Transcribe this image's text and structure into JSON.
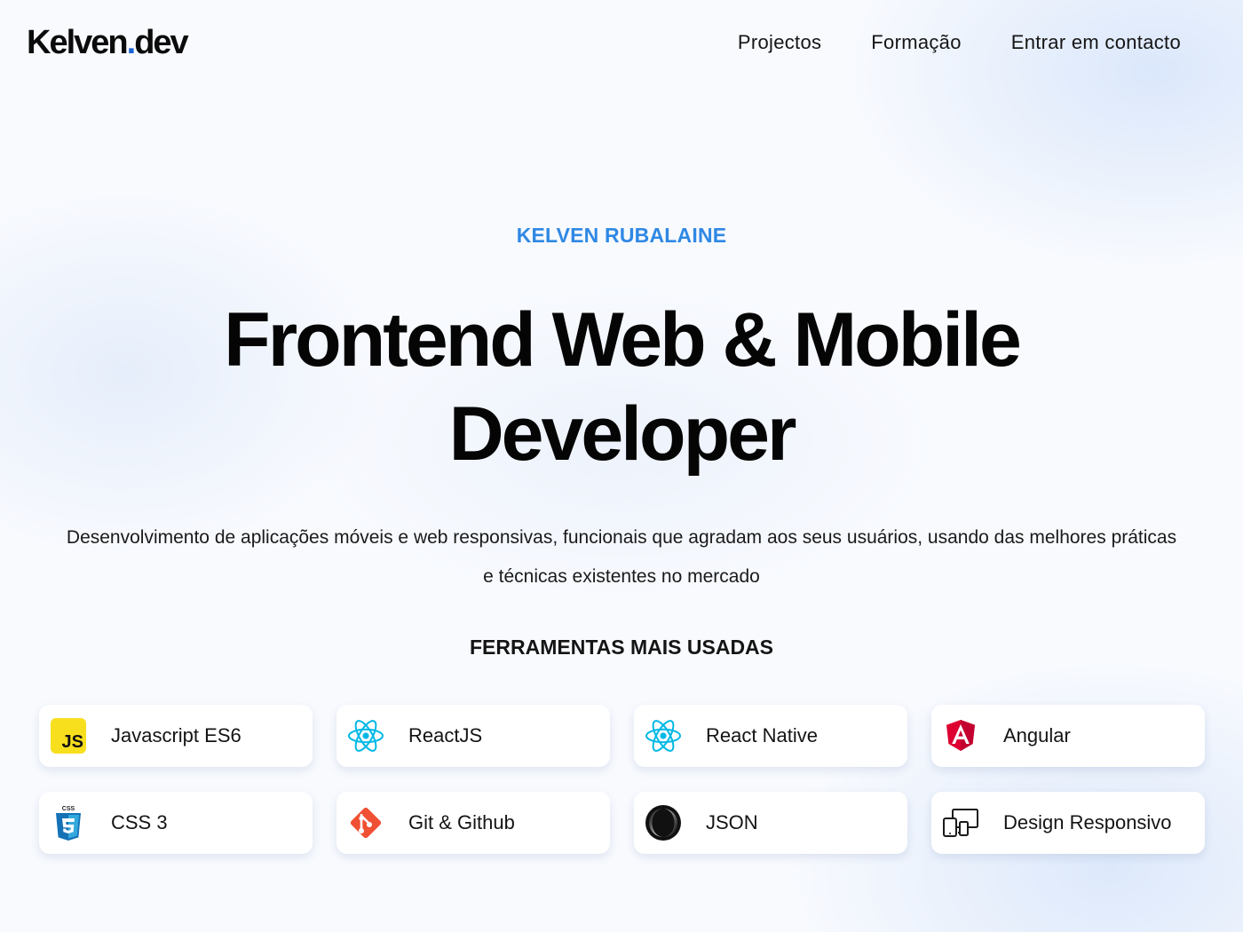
{
  "header": {
    "logo_main": "Kelven",
    "logo_dot": ".",
    "logo_suffix": "dev",
    "nav": [
      {
        "label": "Projectos"
      },
      {
        "label": "Formação"
      },
      {
        "label": "Entrar em contacto"
      }
    ]
  },
  "hero": {
    "eyebrow": "KELVEN RUBALAINE",
    "title": "Frontend Web & Mobile Developer",
    "description": "Desenvolvimento de aplicações móveis e web responsivas, funcionais que agradam aos seus usuários, usando das melhores práticas e técnicas existentes no mercado"
  },
  "tools": {
    "heading": "FERRAMENTAS MAIS USADAS",
    "items": [
      {
        "label": "Javascript ES6",
        "icon": "javascript-icon"
      },
      {
        "label": "ReactJS",
        "icon": "react-icon"
      },
      {
        "label": "React Native",
        "icon": "react-native-icon"
      },
      {
        "label": "Angular",
        "icon": "angular-icon"
      },
      {
        "label": "CSS 3",
        "icon": "css3-icon"
      },
      {
        "label": "Git & Github",
        "icon": "git-icon"
      },
      {
        "label": "JSON",
        "icon": "json-icon"
      },
      {
        "label": "Design Responsivo",
        "icon": "responsive-devices-icon"
      }
    ]
  },
  "icon_text": {
    "js": "JS",
    "css": "CSS"
  },
  "colors": {
    "accent": "#2f88e4",
    "logo_dot": "#1a63d6",
    "js_yellow": "#f7df1e",
    "react_cyan": "#00d8ff",
    "angular_red": "#dd0031",
    "css_blue": "#1572b6",
    "git_orange": "#f05033"
  }
}
